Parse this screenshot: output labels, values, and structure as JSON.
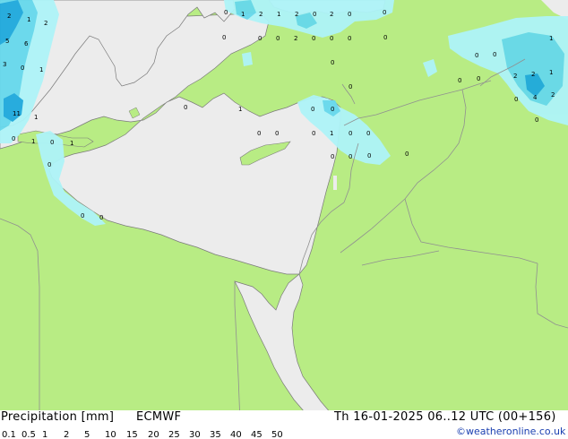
{
  "title": "Precipitation [mm]",
  "model": "ECMWF",
  "valid_time": "Th 16-01-2025 06..12 UTC (00+156)",
  "copyright": "©weatheronline.co.uk",
  "colors": {
    "land": "#b8ec84",
    "sea": "#ececec",
    "border": "#909090",
    "coast": "#7a7a7a",
    "precip_light": "#aef4f8",
    "precip_mid": "#66d9ec",
    "precip_high": "#1ea9dd"
  },
  "legend": {
    "ticks": [
      "0.1",
      "0.5",
      "1",
      "2",
      "5",
      "10",
      "15",
      "20",
      "25",
      "30",
      "35",
      "40",
      "45",
      "50"
    ],
    "colors": [
      "#f0fafe",
      "#c4f4f8",
      "#8ee8f2",
      "#62d2ee",
      "#2eaee0",
      "#1a86cc",
      "#1656b4",
      "#0c2a96",
      "#080e6e",
      "#8a08c8",
      "#aa0ad8",
      "#c80ee4",
      "#e012ec",
      "#f030d8"
    ]
  },
  "map_labels": [
    {
      "t": "2"
    },
    {
      "t": "1"
    },
    {
      "t": "2"
    },
    {
      "t": "5"
    },
    {
      "t": "6"
    },
    {
      "t": "3"
    },
    {
      "t": "0"
    },
    {
      "t": "1"
    },
    {
      "t": "11"
    },
    {
      "t": "1"
    },
    {
      "t": "0"
    },
    {
      "t": "1"
    },
    {
      "t": "0"
    },
    {
      "t": "1"
    },
    {
      "t": "0"
    },
    {
      "t": "0"
    },
    {
      "t": "0"
    },
    {
      "t": "0"
    },
    {
      "t": "1"
    },
    {
      "t": "2"
    },
    {
      "t": "1"
    },
    {
      "t": "2"
    },
    {
      "t": "0"
    },
    {
      "t": "2"
    },
    {
      "t": "0"
    },
    {
      "t": "0"
    },
    {
      "t": "0"
    },
    {
      "t": "0"
    },
    {
      "t": "0"
    },
    {
      "t": "2"
    },
    {
      "t": "0"
    },
    {
      "t": "0"
    },
    {
      "t": "0"
    },
    {
      "t": "0"
    },
    {
      "t": "0"
    },
    {
      "t": "0"
    },
    {
      "t": "1"
    },
    {
      "t": "0"
    },
    {
      "t": "0"
    },
    {
      "t": "0"
    },
    {
      "t": "1"
    },
    {
      "t": "0"
    },
    {
      "t": "0"
    },
    {
      "t": "0"
    },
    {
      "t": "0"
    },
    {
      "t": "0"
    },
    {
      "t": "0"
    },
    {
      "t": "0"
    },
    {
      "t": "0"
    },
    {
      "t": "0"
    },
    {
      "t": "0"
    },
    {
      "t": "0"
    },
    {
      "t": "0"
    },
    {
      "t": "0"
    },
    {
      "t": "1"
    },
    {
      "t": "2"
    },
    {
      "t": "2"
    },
    {
      "t": "1"
    },
    {
      "t": "4"
    },
    {
      "t": "2"
    },
    {
      "t": "0"
    },
    {
      "t": "0"
    }
  ]
}
